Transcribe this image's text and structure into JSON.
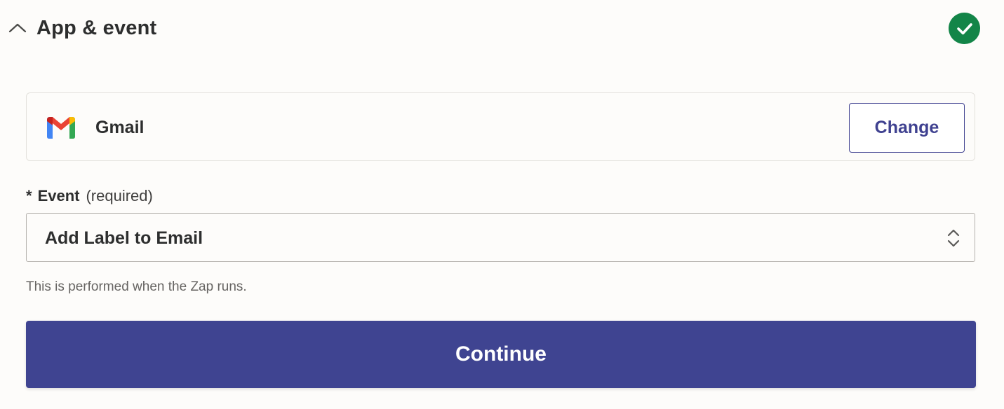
{
  "section": {
    "title": "App & event",
    "collapse_icon": "chevron-up-icon",
    "status_icon": "check-circle-icon",
    "status_color": "#138548"
  },
  "app": {
    "name": "Gmail",
    "logo_icon": "gmail-logo-icon",
    "change_label": "Change"
  },
  "event_field": {
    "required_marker": "*",
    "label": "Event",
    "hint": "(required)",
    "value": "Add Label to Email",
    "helper_text": "This is performed when the Zap runs.",
    "arrows_icon": "select-arrows-icon"
  },
  "actions": {
    "continue_label": "Continue"
  },
  "colors": {
    "accent": "#3f4491",
    "background": "#fdfcfa",
    "text": "#2d2e2e"
  }
}
